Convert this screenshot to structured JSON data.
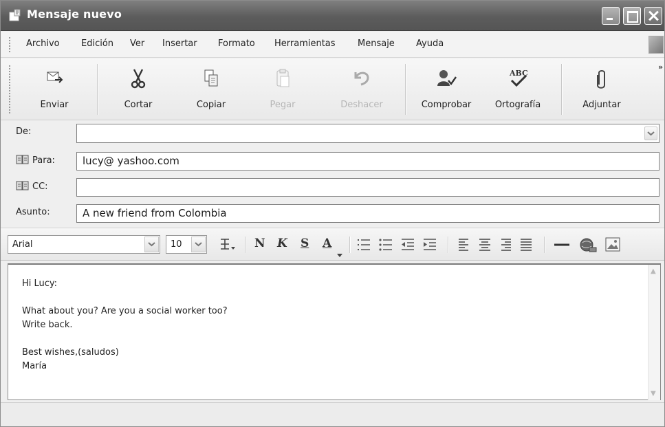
{
  "window": {
    "title": "Mensaje nuevo"
  },
  "menu": [
    "Archivo",
    "Edición",
    "Ver",
    "Insertar",
    "Formato",
    "Herramientas",
    "Mensaje",
    "Ayuda"
  ],
  "toolbar": {
    "send": "Enviar",
    "cut": "Cortar",
    "copy": "Copiar",
    "paste": "Pegar",
    "undo": "Deshacer",
    "check": "Comprobar",
    "spelling": "Ortografía",
    "attach": "Adjuntar",
    "more": "»"
  },
  "fields": {
    "from_label": "De:",
    "from_value": "",
    "to_label": "Para:",
    "to_value": "lucy@ yashoo.com",
    "cc_label": "CC:",
    "cc_value": "",
    "subject_label": "Asunto:",
    "subject_value": "A new friend from Colombia"
  },
  "format": {
    "font": "Arial",
    "size": "10",
    "bold": "N",
    "italic": "K",
    "underline": "S",
    "color": "A"
  },
  "body": {
    "lines": [
      "Hi Lucy:",
      "",
      "What about you? Are you a social worker too?",
      "Write back.",
      "",
      "Best wishes,(saludos)",
      "María"
    ]
  }
}
